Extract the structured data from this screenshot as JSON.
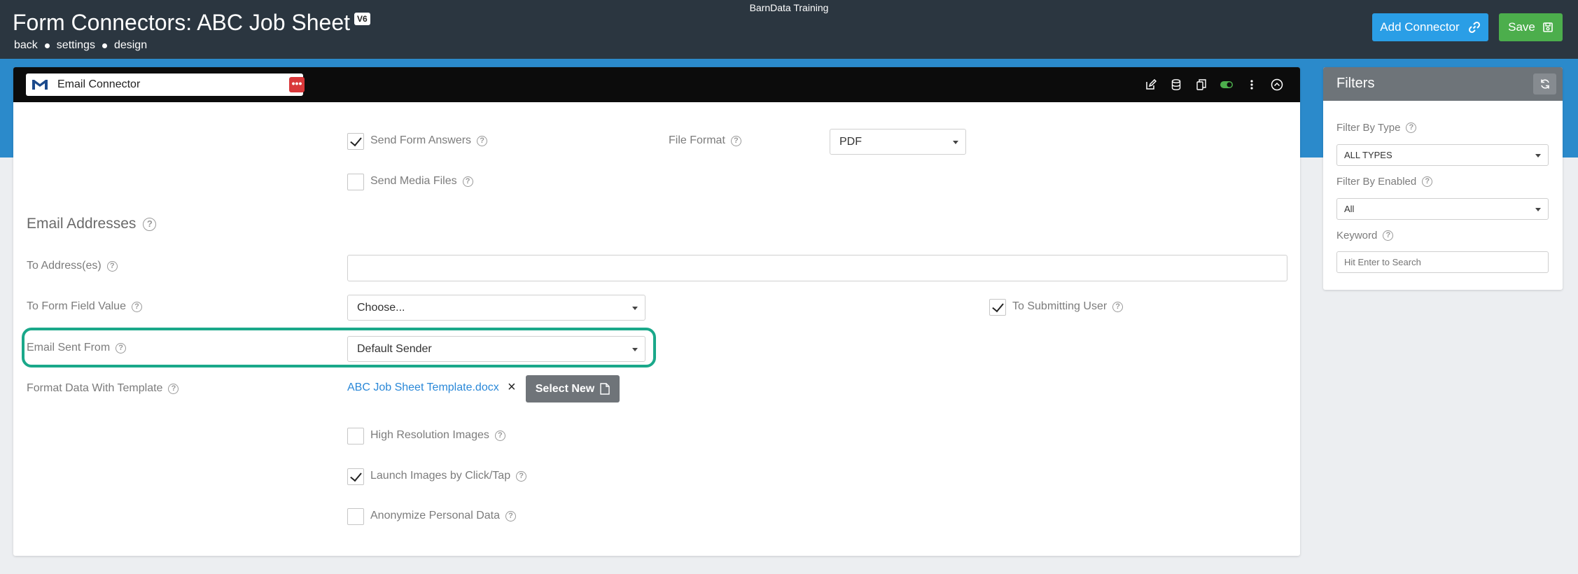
{
  "app": {
    "name": "BarnData Training"
  },
  "header": {
    "title": "Form Connectors: ABC Job Sheet",
    "version": "V6",
    "breadcrumb": [
      "back",
      "settings",
      "design"
    ],
    "add_connector_label": "Add Connector",
    "save_label": "Save"
  },
  "connector": {
    "name": "Email Connector",
    "send_form_answers": {
      "label": "Send Form Answers",
      "checked": true
    },
    "send_media_files": {
      "label": "Send Media Files",
      "checked": false
    },
    "file_format": {
      "label": "File Format",
      "value": "PDF"
    },
    "email_addresses_title": "Email Addresses",
    "to_addresses": {
      "label": "To Address(es)",
      "value": ""
    },
    "to_form_field_value": {
      "label": "To Form Field Value",
      "value": "Choose..."
    },
    "to_submitting_user": {
      "label": "To Submitting User",
      "checked": true
    },
    "email_sent_from": {
      "label": "Email Sent From",
      "value": "Default Sender"
    },
    "format_template": {
      "label": "Format Data With Template",
      "file": "ABC Job Sheet Template.docx",
      "remove_glyph": "×",
      "select_new_label": "Select New"
    },
    "high_resolution_images": {
      "label": "High Resolution Images",
      "checked": false
    },
    "launch_images": {
      "label": "Launch Images by Click/Tap",
      "checked": true
    },
    "anonymize": {
      "label": "Anonymize Personal Data",
      "checked": false
    }
  },
  "filters": {
    "title": "Filters",
    "by_type": {
      "label": "Filter By Type",
      "value": "ALL TYPES"
    },
    "by_enabled": {
      "label": "Filter By Enabled",
      "value": "All"
    },
    "keyword": {
      "label": "Keyword",
      "placeholder": "Hit Enter to Search"
    }
  },
  "colors": {
    "topbar": "#2b3640",
    "band": "#2b8acb",
    "add_button": "#2a9ee6",
    "save_button": "#4cae4c",
    "highlight": "#1aa88a",
    "link": "#2a88d8"
  },
  "icons": {
    "connector": "gmail-icon",
    "add_connector": "link-icon",
    "save": "save-icon",
    "header_actions": [
      "edit-icon",
      "database-icon",
      "copy-icon",
      "toggle-icon",
      "kebab-menu-icon",
      "collapse-icon"
    ],
    "filters_refresh": "refresh-icon",
    "select_new": "file-icon",
    "help": "question-circle-icon"
  }
}
